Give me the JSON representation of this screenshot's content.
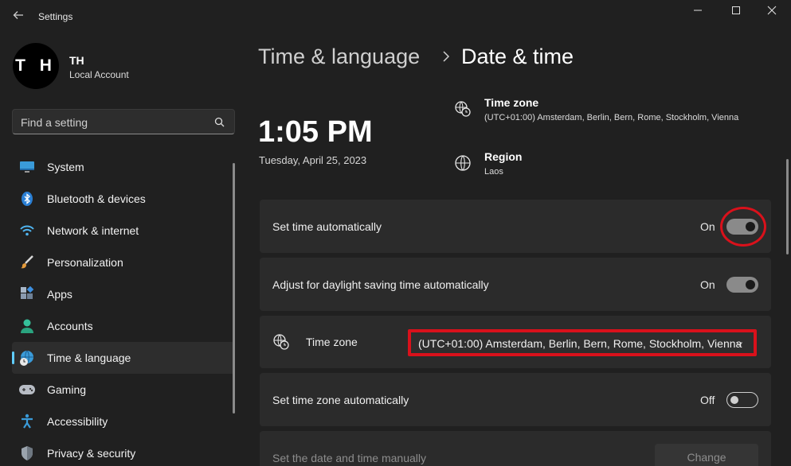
{
  "app": {
    "title": "Settings"
  },
  "profile": {
    "initials": "T H",
    "name": "TH",
    "account_type": "Local Account"
  },
  "search": {
    "placeholder": "Find a setting"
  },
  "sidebar": {
    "items": [
      {
        "label": "System",
        "icon": "monitor-icon"
      },
      {
        "label": "Bluetooth & devices",
        "icon": "bluetooth-icon"
      },
      {
        "label": "Network & internet",
        "icon": "wifi-icon"
      },
      {
        "label": "Personalization",
        "icon": "brush-icon"
      },
      {
        "label": "Apps",
        "icon": "apps-icon"
      },
      {
        "label": "Accounts",
        "icon": "person-icon"
      },
      {
        "label": "Time & language",
        "icon": "globe-clock-icon",
        "active": true
      },
      {
        "label": "Gaming",
        "icon": "gamepad-icon"
      },
      {
        "label": "Accessibility",
        "icon": "accessibility-icon"
      },
      {
        "label": "Privacy & security",
        "icon": "shield-icon"
      }
    ]
  },
  "header": {
    "parent": "Time & language",
    "current": "Date & time"
  },
  "clock": {
    "time": "1:05 PM",
    "date": "Tuesday, April 25, 2023"
  },
  "info": {
    "timezone": {
      "title": "Time zone",
      "value": "(UTC+01:00) Amsterdam, Berlin, Bern, Rome, Stockholm, Vienna"
    },
    "region": {
      "title": "Region",
      "value": "Laos"
    }
  },
  "settings": {
    "set_time_auto": {
      "label": "Set time automatically",
      "state": "On"
    },
    "daylight_saving": {
      "label": "Adjust for daylight saving time automatically",
      "state": "On"
    },
    "time_zone": {
      "label": "Time zone",
      "selected": "(UTC+01:00) Amsterdam, Berlin, Bern, Rome, Stockholm, Vienna"
    },
    "set_tz_auto": {
      "label": "Set time zone automatically",
      "state": "Off"
    },
    "manual": {
      "label": "Set the date and time manually",
      "button": "Change"
    }
  },
  "colors": {
    "accent": "#60cdff",
    "highlight": "#d9111b",
    "background": "#202020",
    "card": "#2b2b2b"
  }
}
